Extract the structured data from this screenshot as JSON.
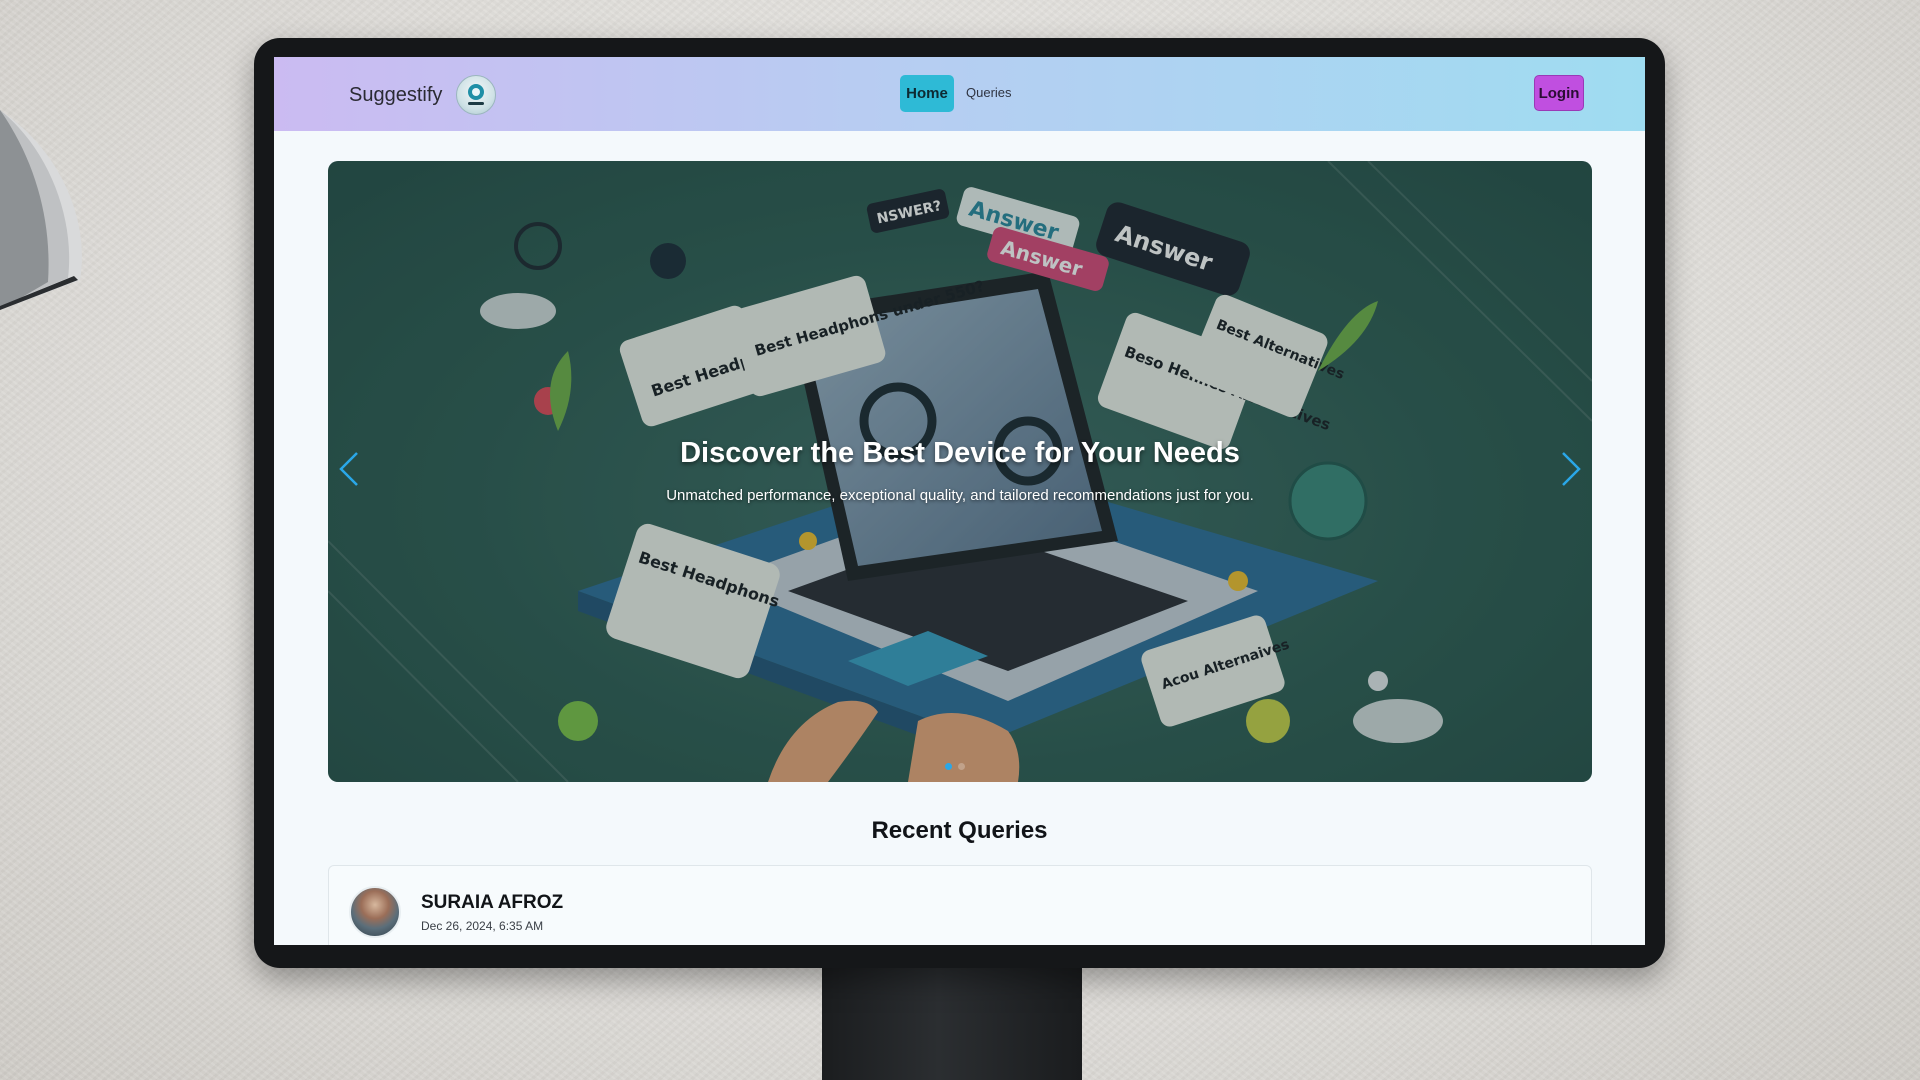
{
  "navbar": {
    "brand": "Suggestify",
    "links": [
      {
        "label": "Home",
        "active": true
      },
      {
        "label": "Queries",
        "active": false
      }
    ],
    "login_label": "Login"
  },
  "carousel": {
    "title": "Discover the Best Device for Your Needs",
    "subtitle": "Unmatched performance, exceptional quality, and tailored recommendations just for you.",
    "art_texts": [
      "Best Headphons under 50",
      "Best Headphons under 550?",
      "Answer",
      "Answer",
      "Answer",
      "Beso Hennes Alternatives",
      "Best Alternatives",
      "Best Headphons",
      "Acou Alternaives",
      "NSWER?"
    ],
    "active_slide": 1,
    "slide_count": 2
  },
  "recent": {
    "title": "Recent Queries",
    "items": [
      {
        "user": "SURAIA AFROZ",
        "date": "Dec 26, 2024, 6:35 AM"
      }
    ]
  },
  "colors": {
    "nav_gradient_start": "#cbbbf2",
    "nav_gradient_end": "#9fdcf1",
    "home_active": "#2ebad6",
    "login": "#c04fe0",
    "arrow": "#2aa7e8"
  }
}
